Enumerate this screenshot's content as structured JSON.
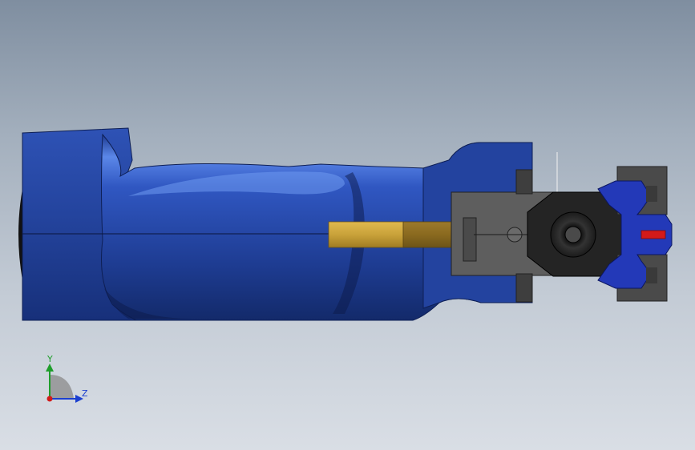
{
  "viewport": {
    "background_top": "#7f8ea0",
    "background_bottom": "#d9dee5"
  },
  "model": {
    "body_color": "#22409a",
    "body_highlight": "#5a86e6",
    "body_shadow": "#0e1f55",
    "shaft_color": "#c9a23a",
    "shaft_dark": "#8a6a1f",
    "bracket_color": "#5e5e5e",
    "chuck_color": "#2a2a2a",
    "clamp_color": "#2339b8",
    "pin_color": "#d21a1a"
  },
  "triad": {
    "y_label": "Y",
    "z_label": "Z",
    "y_color": "#1f9e2b",
    "z_color": "#1b3fcf",
    "origin_color": "#d21a1a"
  }
}
